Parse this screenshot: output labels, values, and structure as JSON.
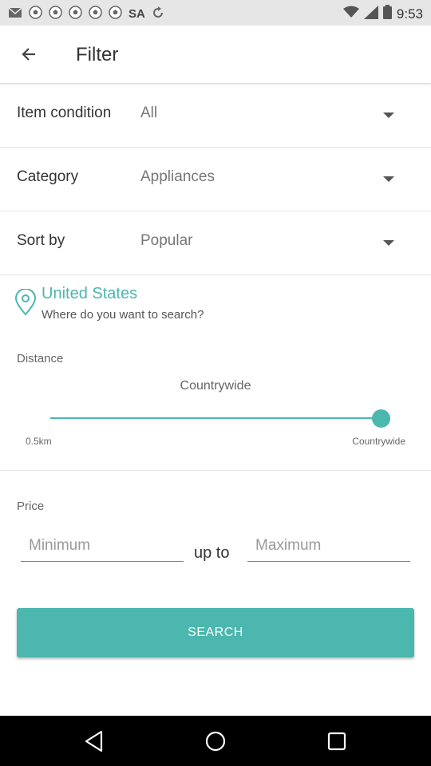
{
  "status_bar": {
    "time": "9:53",
    "carrier_label": "SA",
    "icons": [
      "email-icon",
      "soccer-ball-icon",
      "soccer-ball-icon",
      "soccer-ball-icon",
      "soccer-ball-icon",
      "soccer-ball-icon",
      "wifi-icon",
      "signal-icon",
      "battery-icon"
    ]
  },
  "appbar": {
    "title": "Filter",
    "back_icon": "back-arrow-icon"
  },
  "filters": {
    "item_condition": {
      "label": "Item condition",
      "value": "All"
    },
    "category": {
      "label": "Category",
      "value": "Appliances"
    },
    "sort_by": {
      "label": "Sort by",
      "value": "Popular"
    }
  },
  "location": {
    "icon": "location-pin-icon",
    "title": "United States",
    "subtitle": "Where do you want to search?"
  },
  "distance": {
    "label": "Distance",
    "value": "Countrywide",
    "min_label": "0.5km",
    "max_label": "Countrywide",
    "slider_fraction": 1.0
  },
  "price": {
    "label": "Price",
    "min_placeholder": "Minimum",
    "max_placeholder": "Maximum",
    "separator": "up to"
  },
  "search_button": {
    "label": "SEARCH"
  },
  "colors": {
    "accent": "#4bb7ae",
    "status_bar": "#e6e6e6",
    "nav_bar": "#000000"
  },
  "nav_bar": {
    "icons": [
      "back-triangle-icon",
      "home-circle-icon",
      "recents-square-icon"
    ]
  }
}
